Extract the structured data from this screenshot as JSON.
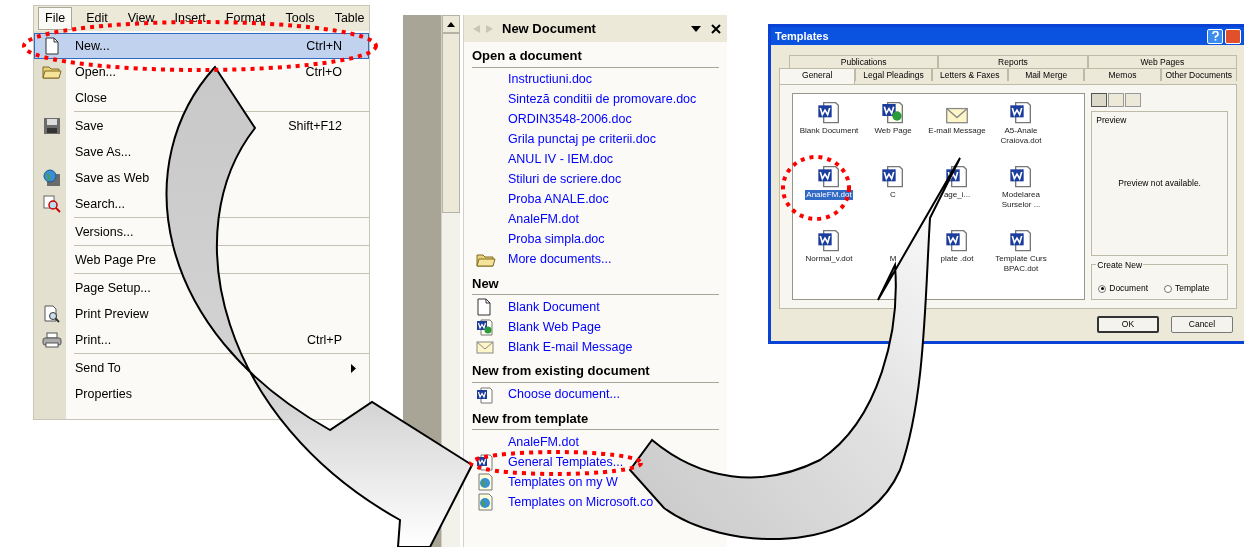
{
  "file_menu": {
    "menubar": [
      {
        "label": "File",
        "selected": true
      },
      {
        "label": "Edit",
        "selected": false
      },
      {
        "label": "View",
        "selected": false
      },
      {
        "label": "Insert",
        "selected": false
      },
      {
        "label": "Format",
        "selected": false
      },
      {
        "label": "Tools",
        "selected": false
      },
      {
        "label": "Table",
        "selected": false
      }
    ],
    "items": [
      {
        "label": "New...",
        "shortcut": "Ctrl+N",
        "has_icon": true,
        "divider_above": false,
        "has_submenu": false,
        "selected": true
      },
      {
        "label": "Open...",
        "shortcut": "Ctrl+O",
        "has_icon": true,
        "divider_above": false,
        "has_submenu": false,
        "selected": false
      },
      {
        "label": "Close",
        "has_icon": false,
        "divider_above": false,
        "has_submenu": false,
        "selected": false
      },
      {
        "label": "Save",
        "shortcut": "Shift+F12",
        "has_icon": true,
        "divider_above": true,
        "has_submenu": false,
        "selected": false
      },
      {
        "label": "Save As...",
        "has_icon": false,
        "divider_above": false,
        "has_submenu": false,
        "selected": false
      },
      {
        "label": "Save as Web",
        "has_icon": true,
        "divider_above": false,
        "has_submenu": false,
        "selected": false
      },
      {
        "label": "Search...",
        "has_icon": true,
        "divider_above": false,
        "has_submenu": false,
        "selected": false
      },
      {
        "label": "Versions...",
        "has_icon": false,
        "divider_above": true,
        "has_submenu": false,
        "selected": false
      },
      {
        "label": "Web Page Pre",
        "has_icon": false,
        "divider_above": true,
        "has_submenu": false,
        "selected": false
      },
      {
        "label": "Page Setup...",
        "has_icon": false,
        "divider_above": true,
        "has_submenu": false,
        "selected": false
      },
      {
        "label": "Print Preview",
        "has_icon": true,
        "divider_above": false,
        "has_submenu": false,
        "selected": false
      },
      {
        "label": "Print...",
        "shortcut": "Ctrl+P",
        "has_icon": true,
        "divider_above": false,
        "has_submenu": false,
        "selected": false
      },
      {
        "label": "Send To",
        "has_icon": false,
        "divider_above": true,
        "has_submenu": true,
        "selected": false
      },
      {
        "label": "Properties",
        "has_icon": false,
        "divider_above": false,
        "has_submenu": false,
        "selected": false
      }
    ]
  },
  "task_pane": {
    "title": "New Document",
    "sections": [
      {
        "heading": "Open a document",
        "links": [
          {
            "label": "Instructiuni.doc",
            "has_icon": false
          },
          {
            "label": "Sinteză conditii de promovare.doc",
            "has_icon": false
          },
          {
            "label": "ORDIN3548-2006.doc",
            "has_icon": false
          },
          {
            "label": "Grila punctaj pe criterii.doc",
            "has_icon": false
          },
          {
            "label": "ANUL IV - IEM.doc",
            "has_icon": false
          },
          {
            "label": "Stiluri de scriere.doc",
            "has_icon": false
          },
          {
            "label": "Proba ANALE.doc",
            "has_icon": false
          },
          {
            "label": "AnaleFM.dot",
            "has_icon": false
          },
          {
            "label": "Proba simpla.doc",
            "has_icon": false
          },
          {
            "label": "More documents...",
            "has_icon": true
          }
        ]
      },
      {
        "heading": "New",
        "links": [
          {
            "label": "Blank Document",
            "has_icon": true
          },
          {
            "label": "Blank Web Page",
            "has_icon": true
          },
          {
            "label": "Blank E-mail Message",
            "has_icon": true
          }
        ]
      },
      {
        "heading": "New from existing document",
        "links": [
          {
            "label": "Choose document...",
            "has_icon": true
          }
        ]
      },
      {
        "heading": "New from template",
        "links": [
          {
            "label": "AnaleFM.dot",
            "has_icon": false
          },
          {
            "label": "General Templates...",
            "has_icon": true
          },
          {
            "label": "Templates on my W",
            "has_icon": true
          },
          {
            "label": "Templates on Microsoft.co",
            "has_icon": true
          }
        ]
      }
    ]
  },
  "templates_dialog": {
    "title": "Templates",
    "tab_rows": [
      [
        {
          "label": "Publications",
          "selected": false
        },
        {
          "label": "Reports",
          "selected": false
        },
        {
          "label": "Web Pages",
          "selected": false
        }
      ],
      [
        {
          "label": "General",
          "selected": true
        },
        {
          "label": "Legal Pleadings",
          "selected": false
        },
        {
          "label": "Letters & Faxes",
          "selected": false
        },
        {
          "label": "Mail Merge",
          "selected": false
        },
        {
          "label": "Memos",
          "selected": false
        },
        {
          "label": "Other Documents",
          "selected": false
        }
      ]
    ],
    "items": [
      {
        "label": "Blank Document",
        "kind": "document",
        "selected": false
      },
      {
        "label": "Web Page",
        "kind": "web",
        "selected": false
      },
      {
        "label": "E-mail Message",
        "kind": "email",
        "selected": false
      },
      {
        "label": "A5-Anale Craiova.dot",
        "kind": "document",
        "selected": false
      },
      {
        "label": "AnaleFM.dot",
        "kind": "document",
        "selected": true
      },
      {
        "label": "C",
        "kind": "document",
        "selected": false
      },
      {
        "label": "age_i...",
        "kind": "document",
        "selected": false
      },
      {
        "label": "Modelarea Surselor ...",
        "kind": "document",
        "selected": false
      },
      {
        "label": "Normal_v.dot",
        "kind": "document",
        "selected": false
      },
      {
        "label": "M",
        "kind": "none",
        "selected": false
      },
      {
        "label": "plate .dot",
        "kind": "document",
        "selected": false
      },
      {
        "label": "Template Curs BPAC.dot",
        "kind": "document",
        "selected": false
      }
    ],
    "preview_label": "Preview",
    "preview_text": "Preview not available.",
    "create_new": {
      "label": "Create New",
      "options": [
        {
          "label": "Document",
          "selected": true
        },
        {
          "label": "Template",
          "selected": false
        }
      ]
    },
    "buttons": [
      "OK",
      "Cancel"
    ]
  }
}
